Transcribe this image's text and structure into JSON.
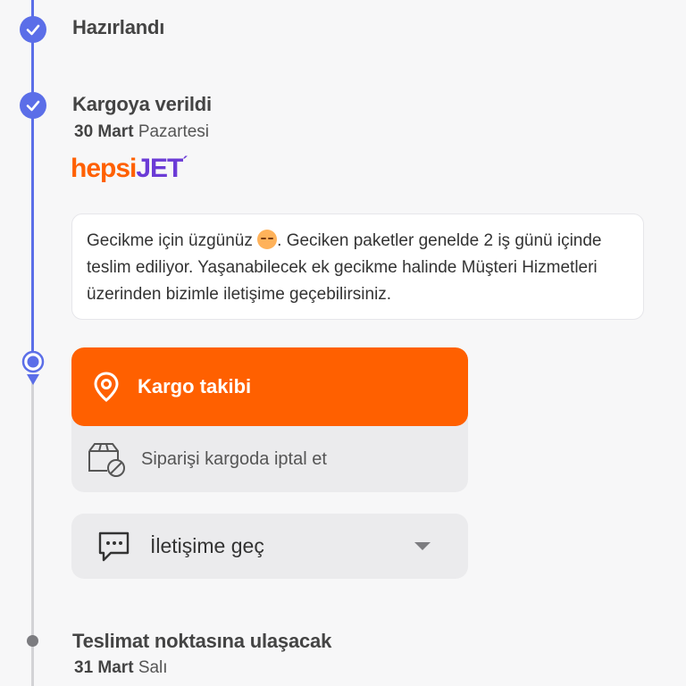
{
  "timeline": {
    "steps": [
      {
        "title": "Hazırlandı",
        "status": "done"
      },
      {
        "title": "Kargoya verildi",
        "date_bold": "30 Mart",
        "date_rest": "Pazartesi",
        "status": "done"
      },
      {
        "title": "Teslimat noktasına ulaşacak",
        "date_bold": "31 Mart",
        "date_rest": "Salı",
        "status": "pending"
      }
    ]
  },
  "carrier": {
    "brand_part1": "hepsi",
    "brand_part2": "JET"
  },
  "delay_note": {
    "text_before_emoji": "Gecikme için üzgünüz ",
    "emoji": "disappointed-face",
    "text_after_emoji": ". Geciken paketler genelde 2 iş günü içinde teslim ediliyor. Yaşanabilecek ek gecikme halinde Müşteri Hizmetleri üzerinden bizimle iletişime geçebilirsiniz."
  },
  "actions": {
    "track_label": "Kargo takibi",
    "cancel_label": "Siparişi kargoda iptal et",
    "contact_label": "İletişime geç"
  },
  "colors": {
    "accent": "#ff6000",
    "timeline": "#5b6ee8",
    "brand_purple": "#6b3bd6"
  },
  "icons": [
    "check-icon",
    "location-pin-icon",
    "box-cancel-icon",
    "chat-icon",
    "chevron-down-icon"
  ]
}
